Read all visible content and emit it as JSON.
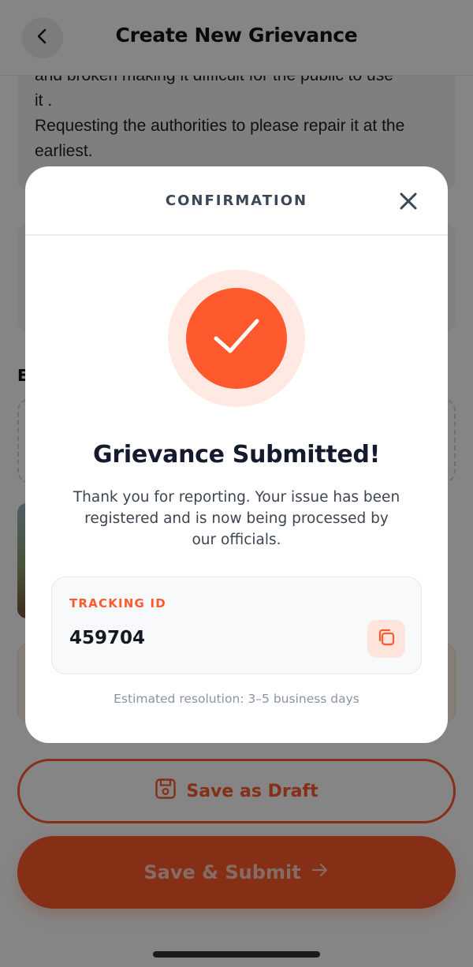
{
  "header": {
    "title": "Create New Grievance",
    "back_icon": "chevron-left-icon"
  },
  "description": {
    "lines": [
      "and broken making it difficult for the public to use",
      "it .",
      "Requesting the authorities to please repair it at the",
      "earliest."
    ]
  },
  "evidence": {
    "label_visible": "E"
  },
  "actions": {
    "draft_label": "Save as Draft",
    "draft_icon": "floppy-disk-icon",
    "submit_label": "Save & Submit",
    "submit_icon": "arrow-right-icon"
  },
  "modal": {
    "title": "CONFIRMATION",
    "close_icon": "close-icon",
    "success_icon": "checkmark-icon",
    "heading": "Grievance Submitted!",
    "message_lines": [
      "Thank you for reporting. Your issue has been",
      "registered and is now being processed by",
      "our officials."
    ],
    "tracking": {
      "label": "TRACKING ID",
      "value": "459704",
      "copy_icon": "copy-icon"
    },
    "estimate": "Estimated resolution: 3–5 business days"
  },
  "colors": {
    "accent": "#ff5a2d",
    "accent_soft": "#ffe9e2",
    "heading": "#151a2e",
    "muted": "#8a94a3"
  }
}
